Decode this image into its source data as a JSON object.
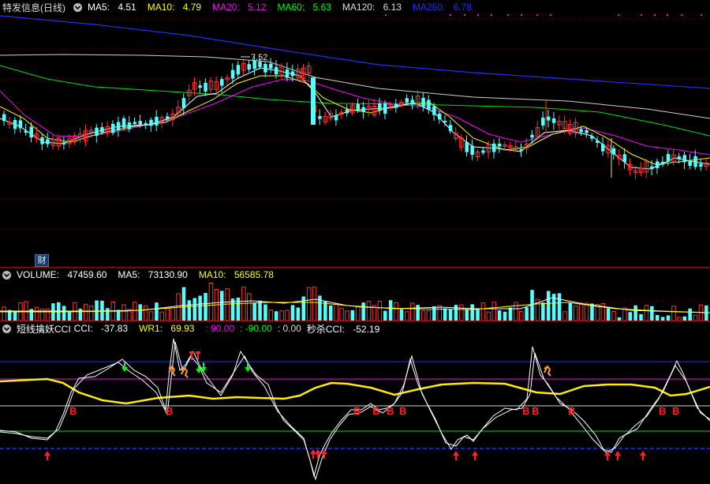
{
  "stock_name": "特发信息(日线)",
  "price_panel": {
    "ma5": {
      "label": "MA5:",
      "value": "4.51",
      "color": "#ffffff"
    },
    "ma10": {
      "label": "MA10:",
      "value": "4.79",
      "color": "#ffff00"
    },
    "ma20": {
      "label": "MA20:",
      "value": "5.12",
      "color": "#ff00ff"
    },
    "ma60": {
      "label": "MA60:",
      "value": "5.63",
      "color": "#00ff00"
    },
    "ma120": {
      "label": "MA120:",
      "value": "6.13",
      "color": "#dddddd"
    },
    "ma250": {
      "label": "MA250:",
      "value": "6.78",
      "color": "#2030ff"
    },
    "high_marker": "7.52",
    "finance_badge": "财"
  },
  "volume_panel": {
    "volume": {
      "label": "VOLUME:",
      "value": "47459.60",
      "color": "#ffffff"
    },
    "ma5": {
      "label": "MA5:",
      "value": "73130.90",
      "color": "#ffffff"
    },
    "ma10": {
      "label": "MA10:",
      "value": "56585.78",
      "color": "#ffff00"
    }
  },
  "indicator_panel": {
    "name": "短线擒妖CCI",
    "cci": {
      "label": "CCI:",
      "value": "-37.83",
      "color": "#ffffff"
    },
    "wr1": {
      "label": "WR1:",
      "value": "69.93",
      "color": "#ffff00"
    },
    "level_high": {
      "value": ": 90.00",
      "color": "#ff00ff"
    },
    "level_low": {
      "value": ": -90.00",
      "color": "#00ff00"
    },
    "level_zero": {
      "value": ": 0.00",
      "color": "#dddddd"
    },
    "miaosha": {
      "label": "秒杀CCI:",
      "value": "-52.19",
      "color": "#ffffff"
    },
    "buy_label": "B"
  },
  "colors": {
    "up": "#ff3232",
    "down": "#54ffff",
    "grid": "#7a0000",
    "background": "#000000"
  },
  "icons": [
    "chevron-down-icon",
    "finance-badge-icon",
    "buy-arrow-icon",
    "sell-arrow-icon",
    "runner-icon"
  ]
}
